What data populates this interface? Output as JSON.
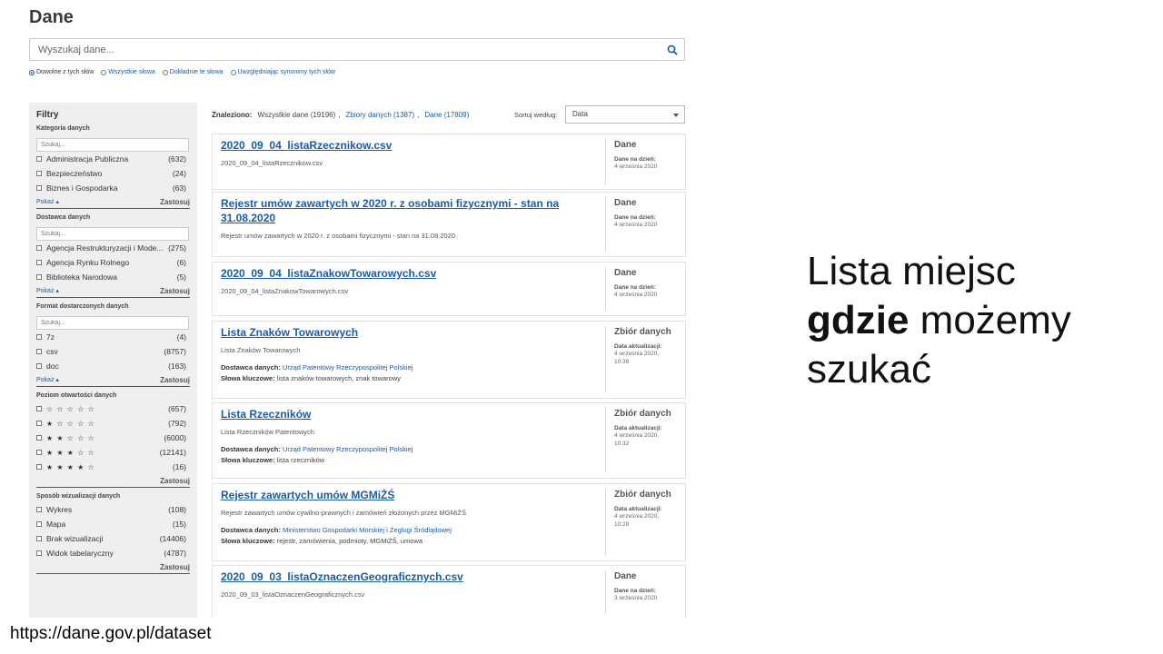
{
  "page": {
    "title": "Dane"
  },
  "search": {
    "placeholder": "Wyszukaj dane..."
  },
  "search_modes": [
    "Dowolne z tych słów",
    "Wszystkie słowa",
    "Dokładnie te słowa",
    "Uwzględniając synonimy tych słów"
  ],
  "filters": {
    "title": "Filtry",
    "search_placeholder": "Szukaj...",
    "show_label": "Pokaż ▴",
    "apply_label": "Zastosuj",
    "category": {
      "title": "Kategoria danych",
      "items": [
        {
          "label": "Administracja Publiczna",
          "count": "(632)"
        },
        {
          "label": "Bezpieczeństwo",
          "count": "(24)"
        },
        {
          "label": "Biznes i Gospodarka",
          "count": "(63)"
        }
      ]
    },
    "provider": {
      "title": "Dostawca danych",
      "items": [
        {
          "label": "Agencja Restrukturyzacji i Mode...",
          "count": "(275)"
        },
        {
          "label": "Agencja Rynku Rolnego",
          "count": "(6)"
        },
        {
          "label": "Biblioteka Narodowa",
          "count": "(5)"
        }
      ]
    },
    "format": {
      "title": "Format dostarczonych danych",
      "items": [
        {
          "label": "7z",
          "count": "(4)"
        },
        {
          "label": "csv",
          "count": "(8757)"
        },
        {
          "label": "doc",
          "count": "(163)"
        }
      ]
    },
    "openness": {
      "title": "Poziom otwartości danych",
      "items": [
        {
          "label": "☆ ☆ ☆ ☆ ☆",
          "count": "(657)"
        },
        {
          "label": "★ ☆ ☆ ☆ ☆",
          "count": "(792)"
        },
        {
          "label": "★ ★ ☆ ☆ ☆",
          "count": "(6000)"
        },
        {
          "label": "★ ★ ★ ☆ ☆",
          "count": "(12141)"
        },
        {
          "label": "★ ★ ★ ★ ☆",
          "count": "(16)"
        }
      ]
    },
    "visualization": {
      "title": "Sposób wizualizacji danych",
      "items": [
        {
          "label": "Wykres",
          "count": "(108)"
        },
        {
          "label": "Mapa",
          "count": "(15)"
        },
        {
          "label": "Brak wizualizacji",
          "count": "(14406)"
        },
        {
          "label": "Widok tabelaryczny",
          "count": "(4787)"
        }
      ]
    }
  },
  "results": {
    "found_label": "Znaleziono:",
    "all_label": "Wszystkie dane (19196)",
    "sets_link": "Zbiory danych (1387)",
    "data_link": "Dane (17809)",
    "sort_label": "Sortuj według:",
    "sort_value": "Data"
  },
  "labels": {
    "provider": "Dostawca danych:",
    "keywords": "Słowa kluczowe:",
    "data_date": "Dane na dzień:",
    "updated": "Data aktualizacji:"
  },
  "cards": [
    {
      "title": "2020_09_04_listaRzecznikow.csv",
      "desc": "2020_09_04_listaRzecznikow.csv",
      "type": "Dane",
      "date_line1": "4 września 2020",
      "date_line2": ""
    },
    {
      "title": "Rejestr umów zawartych w 2020 r. z osobami fizycznymi - stan na 31.08.2020",
      "desc": "Rejestr umów zawartych w 2020 r. z osobami fizycznymi - stan na 31.08.2020",
      "type": "Dane",
      "date_line1": "4 września 2020",
      "date_line2": ""
    },
    {
      "title": "2020_09_04_listaZnakowTowarowych.csv",
      "desc": "2020_09_04_listaZnakowTowarowych.csv",
      "type": "Dane",
      "date_line1": "4 września 2020",
      "date_line2": ""
    },
    {
      "title": "Lista Znaków Towarowych",
      "desc": "Lista Znaków Towarowych",
      "provider": "Urząd Patentowy Rzeczypospolitej Polskiej",
      "keywords": "lista znaków towarowych, znak towarowy",
      "type": "Zbiór danych",
      "date_line1": "4 września 2020,",
      "date_line2": "10:39"
    },
    {
      "title": "Lista Rzeczników",
      "desc": "Lista Rzeczników Patentowych",
      "provider": "Urząd Patentowy Rzeczypospolitej Polskiej",
      "keywords": "lista rzeczników",
      "type": "Zbiór danych",
      "date_line1": "4 września 2020,",
      "date_line2": "10:32"
    },
    {
      "title": "Rejestr zawartych umów MGMiŻŚ",
      "desc": "Rejestr zawartych umów cywilno-prawnych i zamówień złożonych przez MGMiŻŚ",
      "provider": "Ministerstwo Gospodarki Morskiej i Żeglugi Śródlądowej",
      "keywords": "rejestr, zamówienia, podmioty, MGMiŻŚ, umowa",
      "type": "Zbiór danych",
      "date_line1": "4 września 2020,",
      "date_line2": "10:29"
    },
    {
      "title": "2020_09_03_listaOznaczenGeograficznych.csv",
      "desc": "2020_09_03_listaOznaczenGeograficznych.csv",
      "type": "Dane",
      "date_line1": "3 września 2020",
      "date_line2": ""
    }
  ],
  "caption": {
    "url": "https://dane.gov.pl/dataset"
  },
  "slide": {
    "line1": "Lista miejsc",
    "line2_bold": "gdzie",
    "line2_rest": " możemy",
    "line3": "szukać"
  },
  "colors": {
    "link": "#1a5ca8",
    "sidebar_bg": "#efefef"
  },
  "icons": {
    "search": "magnifier-icon"
  }
}
